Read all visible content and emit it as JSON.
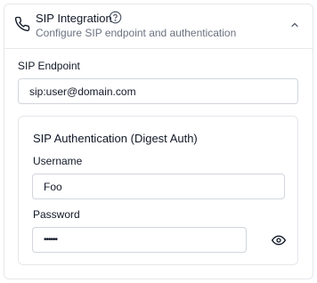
{
  "header": {
    "title": "SIP Integration",
    "subtitle": "Configure SIP endpoint and authentication"
  },
  "endpoint": {
    "label": "SIP Endpoint",
    "value": "sip:user@domain.com"
  },
  "auth": {
    "title": "SIP Authentication (Digest Auth)",
    "username_label": "Username",
    "username_value": "Foo",
    "password_label": "Password",
    "password_value": "••••••"
  }
}
